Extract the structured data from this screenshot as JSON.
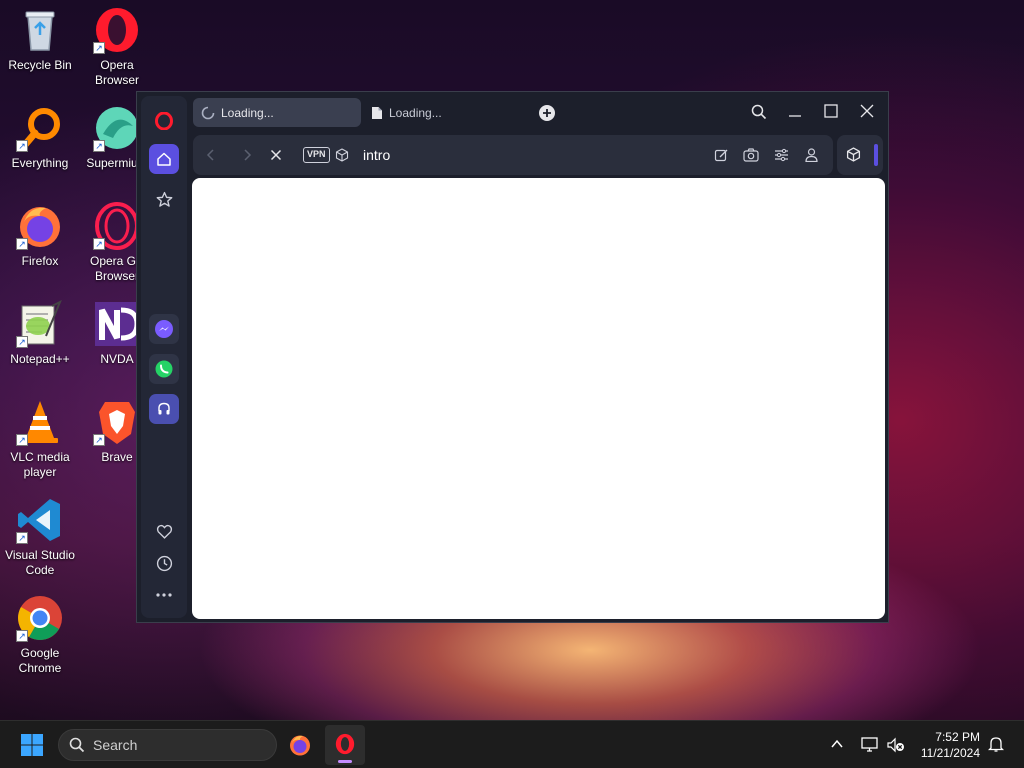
{
  "desktop": {
    "icons": [
      {
        "name": "recycle-bin",
        "label": "Recycle Bin"
      },
      {
        "name": "opera-browser",
        "label": "Opera Browser"
      },
      {
        "name": "everything",
        "label": "Everything"
      },
      {
        "name": "supermium",
        "label": "Supermium"
      },
      {
        "name": "firefox",
        "label": "Firefox"
      },
      {
        "name": "opera-gx",
        "label": "Opera GX Browser"
      },
      {
        "name": "notepad-plus-plus",
        "label": "Notepad++"
      },
      {
        "name": "nvda",
        "label": "NVDA"
      },
      {
        "name": "vlc",
        "label": "VLC media player"
      },
      {
        "name": "brave",
        "label": "Brave"
      },
      {
        "name": "vscode",
        "label": "Visual Studio Code"
      },
      {
        "name": "google-chrome",
        "label": "Google Chrome"
      }
    ]
  },
  "browser": {
    "tabs": [
      {
        "label": "Loading...",
        "active": true
      },
      {
        "label": "Loading...",
        "active": false
      }
    ],
    "address": {
      "vpn_badge": "VPN",
      "url": "intro"
    },
    "sidebar_icons": [
      "opera-logo-icon",
      "home-icon",
      "star-icon",
      "messenger-icon",
      "whatsapp-icon",
      "music-icon",
      "heart-icon",
      "history-icon",
      "more-icon"
    ]
  },
  "taskbar": {
    "search_placeholder": "Search",
    "time": "7:52 PM",
    "date": "11/21/2024"
  },
  "colors": {
    "opera_red": "#ff1b2d",
    "sidebar_accent": "#5b4fe0",
    "window_bg": "#1c1f2b"
  }
}
